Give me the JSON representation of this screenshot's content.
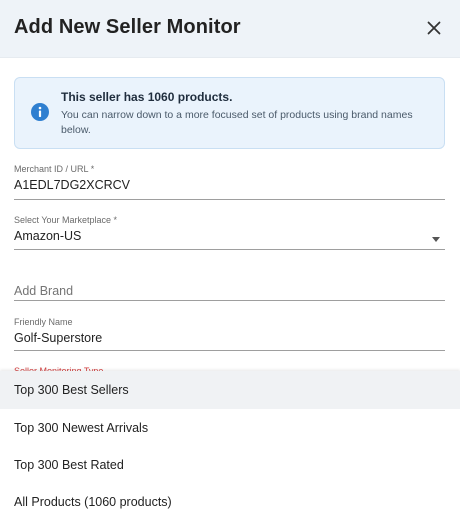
{
  "dialog": {
    "title": "Add New Seller Monitor"
  },
  "info": {
    "icon": "info-icon",
    "title": "This seller has 1060 products.",
    "text": "You can narrow down to a more focused set of products using brand names below."
  },
  "fields": {
    "merchant": {
      "label": "Merchant ID / URL *",
      "value": "A1EDL7DG2XCRCV"
    },
    "marketplace": {
      "label": "Select Your Marketplace *",
      "value": "Amazon-US"
    },
    "brand": {
      "placeholder": "Add Brand"
    },
    "friendly": {
      "label": "Friendly Name",
      "value": "Golf-Superstore"
    },
    "monitoring_type": {
      "label": "Seller Monitoring Type"
    }
  },
  "menu": {
    "options": [
      {
        "label": "Top 300 Best Sellers",
        "selected": true
      },
      {
        "label": "Top 300 Newest Arrivals",
        "selected": false
      },
      {
        "label": "Top 300 Best Rated",
        "selected": false
      },
      {
        "label": "All Products (1060 products)",
        "selected": false
      }
    ]
  },
  "colors": {
    "header_bg": "#eef3f8",
    "info_bg": "#eaf3fc",
    "info_icon": "#2f7fd0",
    "required_label": "#d34040"
  }
}
